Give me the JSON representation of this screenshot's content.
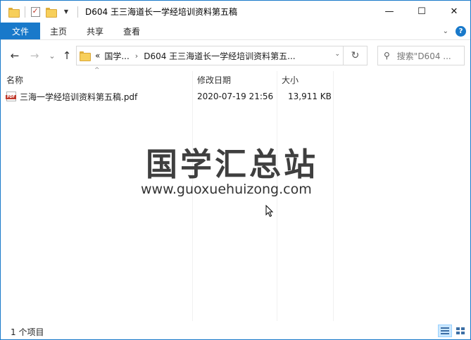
{
  "window": {
    "title": "D604 王三海道长一学经培训资料第五稿",
    "controls": {
      "minimize": "—",
      "maximize": "☐",
      "close": "✕"
    }
  },
  "ribbon": {
    "tabs": [
      "文件",
      "主页",
      "共享",
      "查看"
    ]
  },
  "nav": {
    "back": "←",
    "forward": "→",
    "recent": "⌄",
    "up": "↑",
    "breadcrumb_overflow": "«",
    "breadcrumbs": [
      "国学...",
      "D604 王三海道长一学经培训资料第五..."
    ],
    "refresh": "↻",
    "search_placeholder": "搜索\"D604 ..."
  },
  "columns": {
    "name": "名称",
    "date": "修改日期",
    "size": "大小"
  },
  "files": [
    {
      "name": "三海一学经培训资料第五稿.pdf",
      "date": "2020-07-19 21:56",
      "size": "13,911 KB",
      "icon": "pdf-icon"
    }
  ],
  "watermark": {
    "title": "国学汇总站",
    "url": "www.guoxuehuizong.com"
  },
  "status": {
    "item_count": "1 个项目"
  },
  "colors": {
    "accent": "#1979ca",
    "folder": "#f7cf5a",
    "pdf": "#c0392b"
  }
}
